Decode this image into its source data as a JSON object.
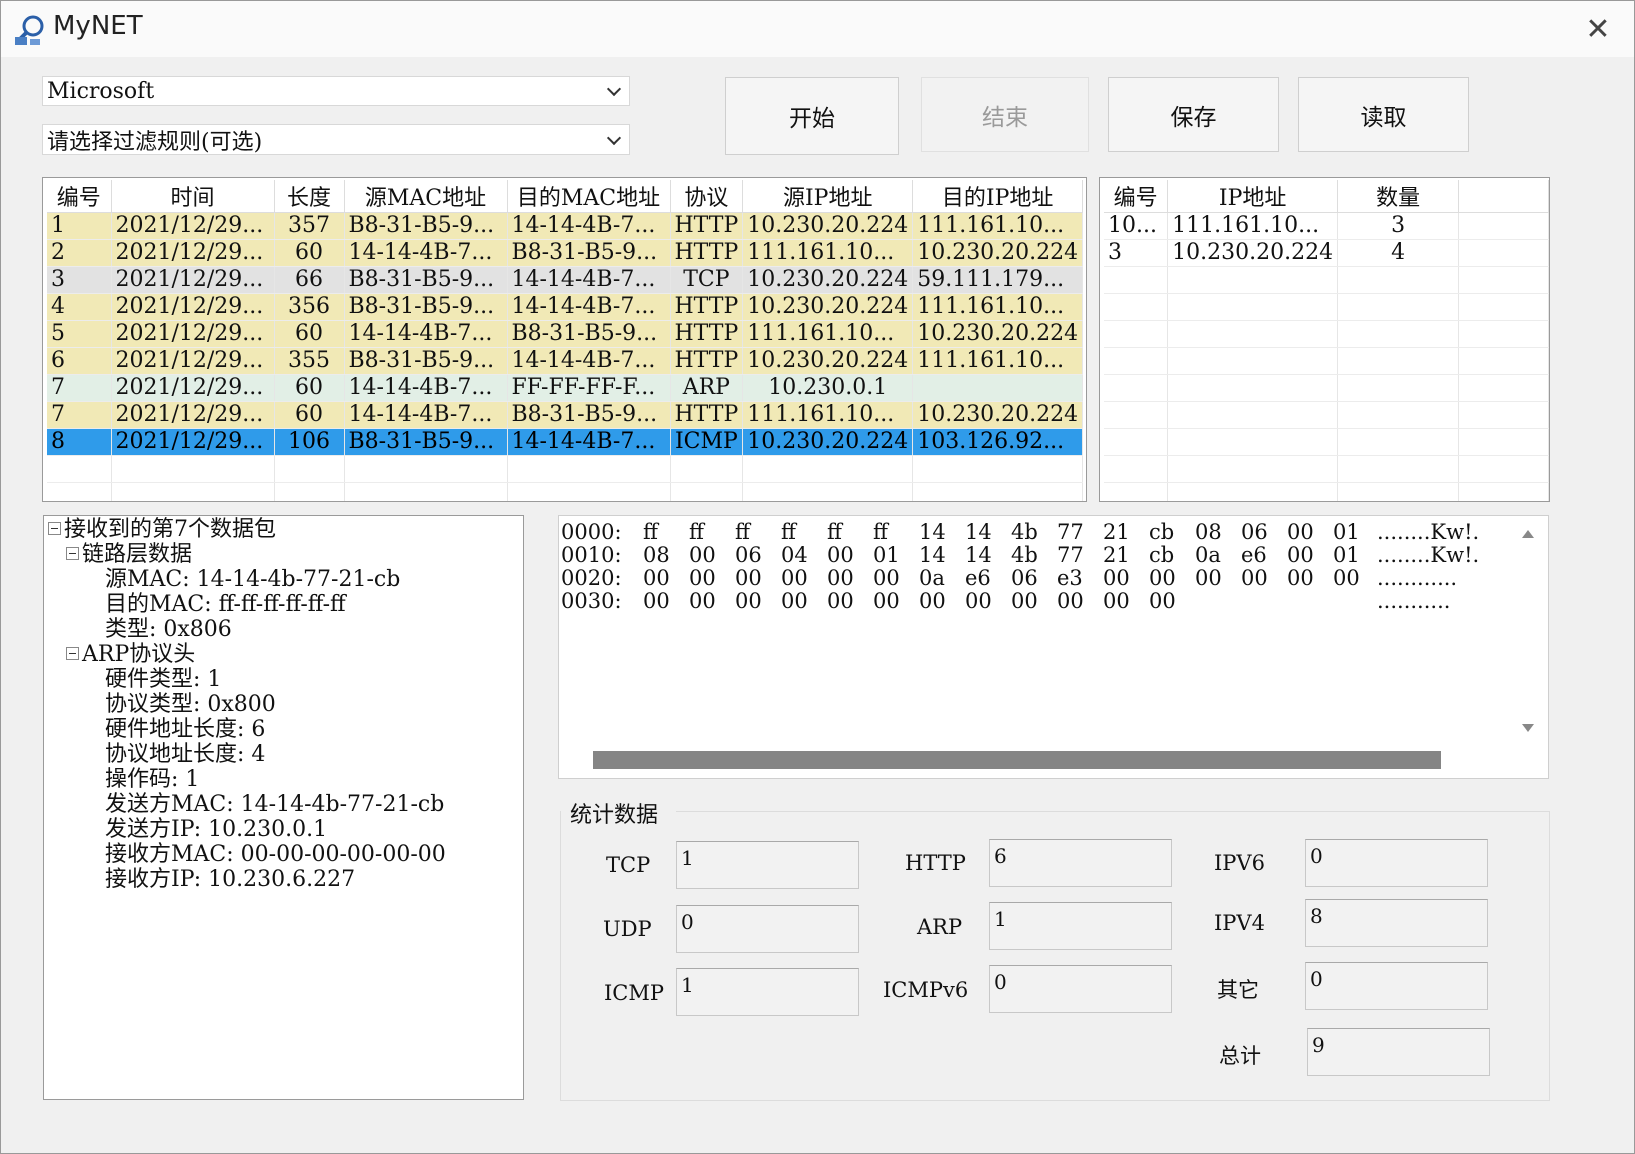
{
  "window": {
    "title": "MyNET",
    "close_glyph": "✕"
  },
  "controls": {
    "adapter_select": "Microsoft",
    "filter_select": "请选择过滤规则(可选)",
    "start_button": "开始",
    "stop_button": "结束",
    "save_button": "保存",
    "load_button": "读取"
  },
  "packet_table": {
    "headers": [
      "编号",
      "时间",
      "长度",
      "源MAC地址",
      "目的MAC地址",
      "协议",
      "源IP地址",
      "目的IP地址"
    ],
    "rows": [
      {
        "type": "http",
        "cells": [
          "1",
          "2021/12/29...",
          "357",
          "B8-31-B5-9...",
          "14-14-4B-7...",
          "HTTP",
          "10.230.20.224",
          "111.161.10..."
        ]
      },
      {
        "type": "http",
        "cells": [
          "2",
          "2021/12/29...",
          "60",
          "14-14-4B-7...",
          "B8-31-B5-9...",
          "HTTP",
          "111.161.10...",
          "10.230.20.224"
        ]
      },
      {
        "type": "tcp",
        "cells": [
          "3",
          "2021/12/29...",
          "66",
          "B8-31-B5-9...",
          "14-14-4B-7...",
          "TCP",
          "10.230.20.224",
          "59.111.179..."
        ]
      },
      {
        "type": "http",
        "cells": [
          "4",
          "2021/12/29...",
          "356",
          "B8-31-B5-9...",
          "14-14-4B-7...",
          "HTTP",
          "10.230.20.224",
          "111.161.10..."
        ]
      },
      {
        "type": "http",
        "cells": [
          "5",
          "2021/12/29...",
          "60",
          "14-14-4B-7...",
          "B8-31-B5-9...",
          "HTTP",
          "111.161.10...",
          "10.230.20.224"
        ]
      },
      {
        "type": "http",
        "cells": [
          "6",
          "2021/12/29...",
          "355",
          "B8-31-B5-9...",
          "14-14-4B-7...",
          "HTTP",
          "10.230.20.224",
          "111.161.10..."
        ]
      },
      {
        "type": "arp",
        "cells": [
          "7",
          "2021/12/29...",
          "60",
          "14-14-4B-7...",
          "FF-FF-FF-F...",
          "ARP",
          "10.230.0.1",
          ""
        ]
      },
      {
        "type": "http",
        "cells": [
          "7",
          "2021/12/29...",
          "60",
          "14-14-4B-7...",
          "B8-31-B5-9...",
          "HTTP",
          "111.161.10...",
          "10.230.20.224"
        ]
      },
      {
        "type": "sel",
        "cells": [
          "8",
          "2021/12/29...",
          "106",
          "B8-31-B5-9...",
          "14-14-4B-7...",
          "ICMP",
          "10.230.20.224",
          "103.126.92..."
        ]
      }
    ]
  },
  "ip_table": {
    "headers": [
      "编号",
      "IP地址",
      "数量"
    ],
    "rows": [
      [
        "10...",
        "111.161.10...",
        "3"
      ],
      [
        "3",
        "10.230.20.224",
        "4"
      ]
    ]
  },
  "tree": {
    "root": "接收到的第7个数据包",
    "link_layer": "链路层数据",
    "link_fields": [
      "源MAC: 14-14-4b-77-21-cb",
      "目的MAC: ff-ff-ff-ff-ff-ff",
      "类型: 0x806"
    ],
    "arp_header": "ARP协议头",
    "arp_fields": [
      "硬件类型: 1",
      "协议类型: 0x800",
      "硬件地址长度: 6",
      "协议地址长度: 4",
      "操作码: 1",
      "发送方MAC: 14-14-4b-77-21-cb",
      "发送方IP: 10.230.0.1",
      "接收方MAC: 00-00-00-00-00-00",
      "接收方IP: 10.230.6.227"
    ]
  },
  "hex_dump": [
    {
      "offset": "0000:",
      "bytes": [
        "ff",
        "ff",
        "ff",
        "ff",
        "ff",
        "ff",
        "14",
        "14",
        "4b",
        "77",
        "21",
        "cb",
        "08",
        "06",
        "00",
        "01"
      ],
      "ascii": "........Kw!."
    },
    {
      "offset": "0010:",
      "bytes": [
        "08",
        "00",
        "06",
        "04",
        "00",
        "01",
        "14",
        "14",
        "4b",
        "77",
        "21",
        "cb",
        "0a",
        "e6",
        "00",
        "01"
      ],
      "ascii": "........Kw!."
    },
    {
      "offset": "0020:",
      "bytes": [
        "00",
        "00",
        "00",
        "00",
        "00",
        "00",
        "0a",
        "e6",
        "06",
        "e3",
        "00",
        "00",
        "00",
        "00",
        "00",
        "00"
      ],
      "ascii": "............"
    },
    {
      "offset": "0030:",
      "bytes": [
        "00",
        "00",
        "00",
        "00",
        "00",
        "00",
        "00",
        "00",
        "00",
        "00",
        "00",
        "00"
      ],
      "ascii": "..........."
    }
  ],
  "stats": {
    "legend": "统计数据",
    "items": [
      {
        "label": "TCP",
        "value": "1"
      },
      {
        "label": "UDP",
        "value": "0"
      },
      {
        "label": "ICMP",
        "value": "1"
      },
      {
        "label": "HTTP",
        "value": "6"
      },
      {
        "label": "ARP",
        "value": "1"
      },
      {
        "label": "ICMPv6",
        "value": "0"
      },
      {
        "label": "IPV6",
        "value": "0"
      },
      {
        "label": "IPV4",
        "value": "8"
      },
      {
        "label": "其它",
        "value": "0"
      },
      {
        "label": "总计",
        "value": "9"
      }
    ]
  }
}
